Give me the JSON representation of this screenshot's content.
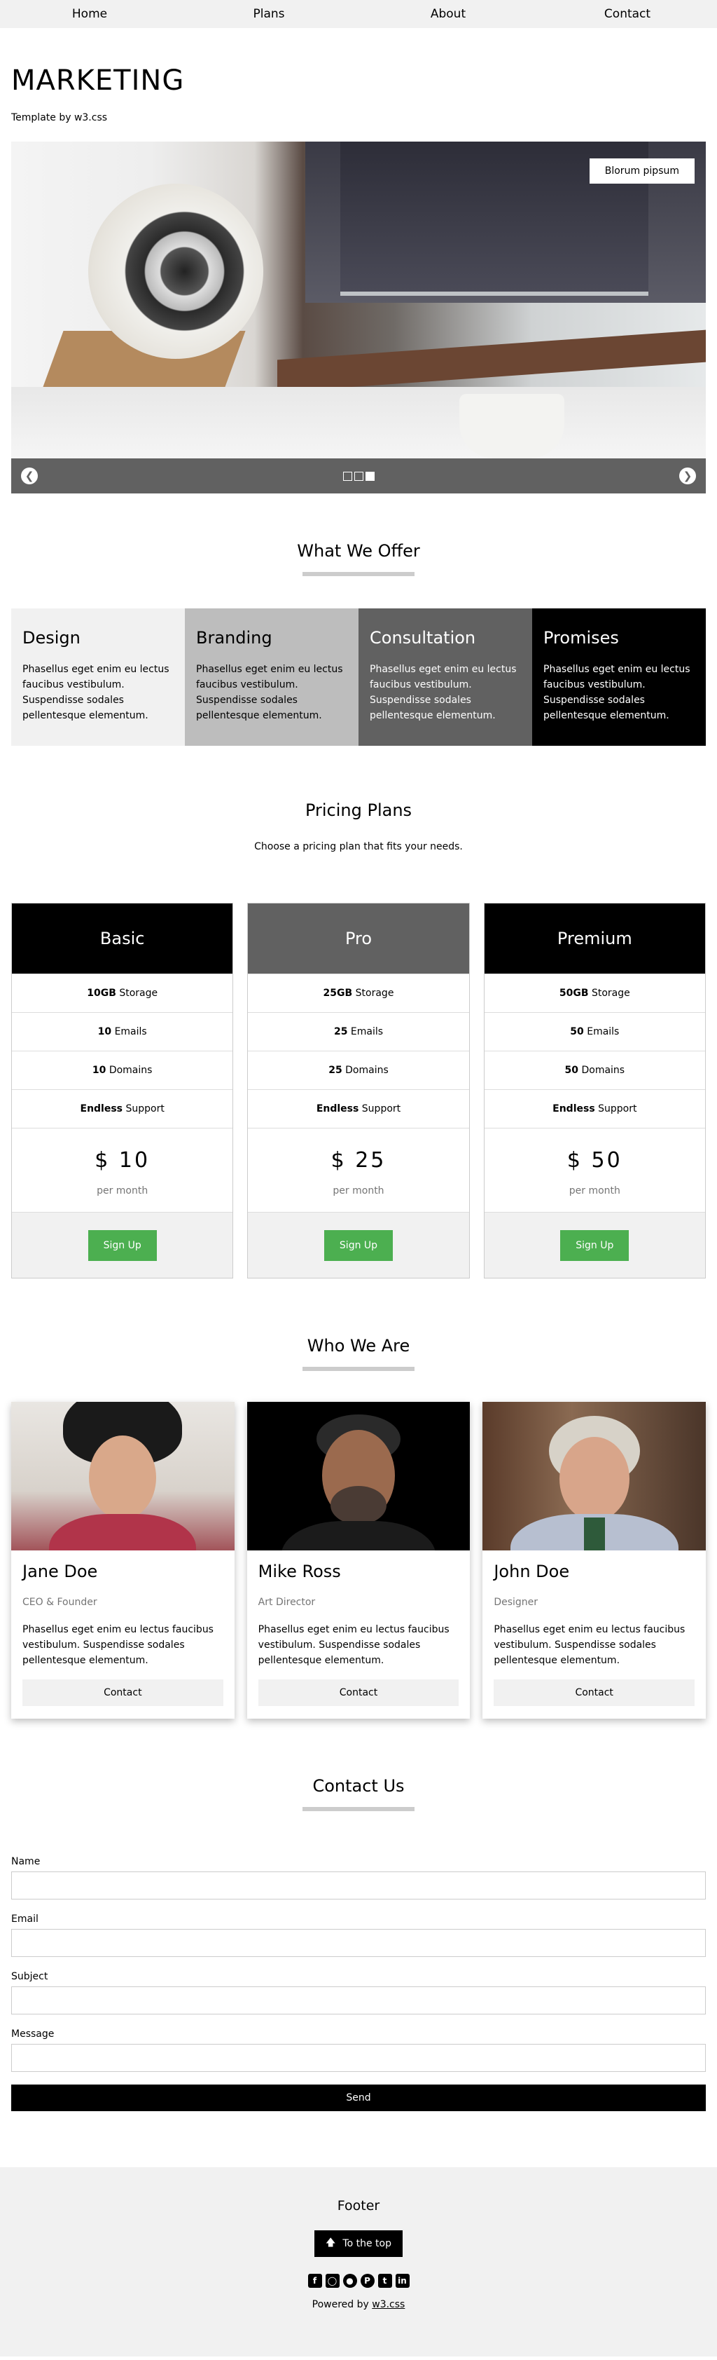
{
  "nav": {
    "items": [
      "Home",
      "Plans",
      "About",
      "Contact"
    ]
  },
  "header": {
    "title": "MARKETING",
    "subtitle": "Template by w3.css"
  },
  "slider": {
    "caption": "Blorum pipsum",
    "prev_icon": "arrow-left-icon",
    "next_icon": "arrow-right-icon",
    "dots": 3,
    "active_dot": 3
  },
  "offer": {
    "title": "What We Offer",
    "items": [
      {
        "title": "Design",
        "text": "Phasellus eget enim eu lectus faucibus vestibulum. Suspendisse sodales pellentesque elementum.",
        "bg": "#f1f1f1",
        "fg": "#000000"
      },
      {
        "title": "Branding",
        "text": "Phasellus eget enim eu lectus faucibus vestibulum. Suspendisse sodales pellentesque elementum.",
        "bg": "#bdbdbd",
        "fg": "#000000"
      },
      {
        "title": "Consultation",
        "text": "Phasellus eget enim eu lectus faucibus vestibulum. Suspendisse sodales pellentesque elementum.",
        "bg": "#616161",
        "fg": "#ffffff"
      },
      {
        "title": "Promises",
        "text": "Phasellus eget enim eu lectus faucibus vestibulum. Suspendisse sodales pellentesque elementum.",
        "bg": "#000000",
        "fg": "#ffffff"
      }
    ]
  },
  "pricing": {
    "title": "Pricing Plans",
    "subtitle": "Choose a pricing plan that fits your needs.",
    "plans": [
      {
        "name": "Basic",
        "head_bg": "#000000",
        "storage_val": "10GB",
        "storage_label": "Storage",
        "emails_val": "10",
        "emails_label": "Emails",
        "domains_val": "10",
        "domains_label": "Domains",
        "support_val": "Endless",
        "support_label": "Support",
        "price": "$ 10",
        "per": "per month",
        "button": "Sign Up"
      },
      {
        "name": "Pro",
        "head_bg": "#616161",
        "storage_val": "25GB",
        "storage_label": "Storage",
        "emails_val": "25",
        "emails_label": "Emails",
        "domains_val": "25",
        "domains_label": "Domains",
        "support_val": "Endless",
        "support_label": "Support",
        "price": "$ 25",
        "per": "per month",
        "button": "Sign Up"
      },
      {
        "name": "Premium",
        "head_bg": "#000000",
        "storage_val": "50GB",
        "storage_label": "Storage",
        "emails_val": "50",
        "emails_label": "Emails",
        "domains_val": "50",
        "domains_label": "Domains",
        "support_val": "Endless",
        "support_label": "Support",
        "price": "$ 50",
        "per": "per month",
        "button": "Sign Up"
      }
    ]
  },
  "team": {
    "title": "Who We Are",
    "members": [
      {
        "name": "Jane Doe",
        "role": "CEO & Founder",
        "text": "Phasellus eget enim eu lectus faucibus vestibulum. Suspendisse sodales pellentesque elementum.",
        "button": "Contact"
      },
      {
        "name": "Mike Ross",
        "role": "Art Director",
        "text": "Phasellus eget enim eu lectus faucibus vestibulum. Suspendisse sodales pellentesque elementum.",
        "button": "Contact"
      },
      {
        "name": "John Doe",
        "role": "Designer",
        "text": "Phasellus eget enim eu lectus faucibus vestibulum. Suspendisse sodales pellentesque elementum.",
        "button": "Contact"
      }
    ]
  },
  "contact": {
    "title": "Contact Us",
    "fields": {
      "name": "Name",
      "email": "Email",
      "subject": "Subject",
      "message": "Message"
    },
    "send": "Send"
  },
  "footer": {
    "title": "Footer",
    "to_top": "To the top",
    "socials": [
      "facebook-icon",
      "instagram-icon",
      "snapchat-icon",
      "pinterest-icon",
      "twitter-icon",
      "linkedin-icon"
    ],
    "powered_prefix": "Powered by",
    "powered_link": "w3.css"
  },
  "colors": {
    "accent_green": "#4CAF50",
    "light_gray": "#f1f1f1",
    "dark_gray": "#616161"
  }
}
